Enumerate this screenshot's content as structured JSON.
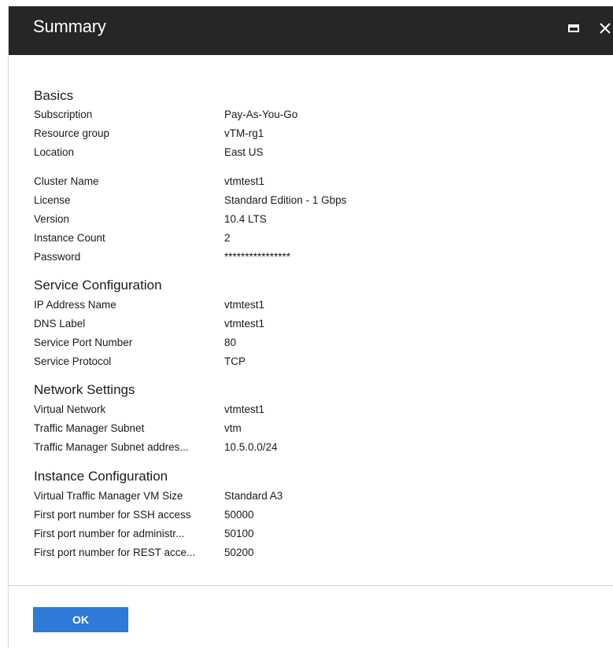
{
  "blade": {
    "title": "Summary",
    "maximize_icon": "maximize-icon",
    "close_icon": "close-icon"
  },
  "sections": {
    "basics": {
      "heading": "Basics",
      "rows": [
        {
          "label": "Subscription",
          "value": "Pay-As-You-Go"
        },
        {
          "label": "Resource group",
          "value": "vTM-rg1"
        },
        {
          "label": "Location",
          "value": "East US"
        },
        {
          "label": "Cluster Name",
          "value": "vtmtest1"
        },
        {
          "label": "License",
          "value": "Standard Edition - 1 Gbps"
        },
        {
          "label": "Version",
          "value": "10.4 LTS"
        },
        {
          "label": "Instance Count",
          "value": "2"
        },
        {
          "label": "Password",
          "value": "****************"
        }
      ]
    },
    "service": {
      "heading": "Service Configuration",
      "rows": [
        {
          "label": "IP Address Name",
          "value": "vtmtest1"
        },
        {
          "label": "DNS Label",
          "value": "vtmtest1"
        },
        {
          "label": "Service Port Number",
          "value": "80"
        },
        {
          "label": "Service Protocol",
          "value": "TCP"
        }
      ]
    },
    "network": {
      "heading": "Network Settings",
      "rows": [
        {
          "label": "Virtual Network",
          "value": "vtmtest1"
        },
        {
          "label": "Traffic Manager Subnet",
          "value": "vtm"
        },
        {
          "label": "Traffic Manager Subnet addres...",
          "value": "10.5.0.0/24"
        }
      ]
    },
    "instance": {
      "heading": "Instance Configuration",
      "rows": [
        {
          "label": "Virtual Traffic Manager VM Size",
          "value": "Standard A3"
        },
        {
          "label": "First port number for SSH access",
          "value": "50000"
        },
        {
          "label": "First port number for administr...",
          "value": "50100"
        },
        {
          "label": "First port number for REST acce...",
          "value": "50200"
        }
      ]
    }
  },
  "footer": {
    "ok_label": "OK",
    "ok_color": "#2e7ad6"
  },
  "colors": {
    "header_bg": "#262626",
    "header_text": "#ffffff",
    "body_text": "#1a1a1a"
  }
}
